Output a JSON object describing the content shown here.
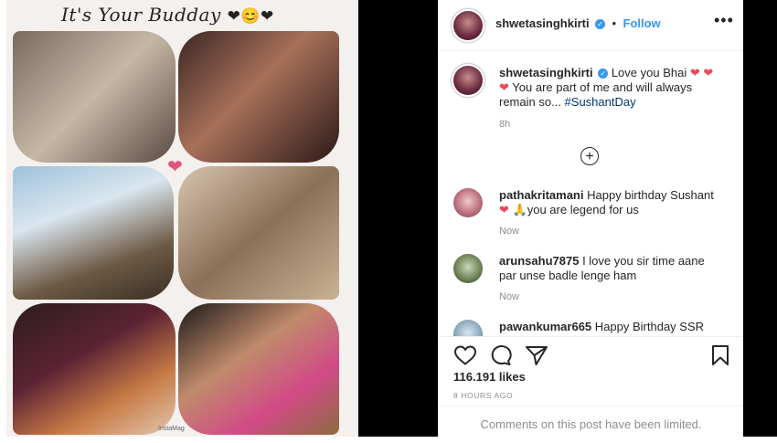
{
  "media": {
    "collage_title": "It's Your Budday",
    "collage_hearts": "❤😊❤",
    "collage_watermark": "InstaMag"
  },
  "header": {
    "username": "shwetasinghkirti",
    "verified_mark": "✓",
    "separator": "•",
    "follow_label": "Follow",
    "more_label": "•••"
  },
  "caption": {
    "username": "shwetasinghkirti",
    "verified_mark": "✓",
    "text_1": "Love you Bhai",
    "heart_1": "❤",
    "heart_2": "❤",
    "heart_3": "❤",
    "text_2": "You are part of me and will always remain so...",
    "hashtag": "#SushantDay",
    "time": "8h"
  },
  "load_more_label": "+",
  "comments": [
    {
      "username": "pathakritamani",
      "text_before": "Happy birthday Sushant",
      "heart": "❤",
      "emoji": "🙏",
      "text_after": "you are legend for us",
      "time": "Now"
    },
    {
      "username": "arunsahu7875",
      "text": "I love you sir time aane par unse badle lenge ham",
      "time": "Now"
    },
    {
      "username": "pawankumar665",
      "text": "Happy Birthday SSR",
      "time": ""
    }
  ],
  "stats": {
    "likes": "116.191 likes",
    "posted": "8 HOURS AGO"
  },
  "footer": {
    "comments_limited": "Comments on this post have been limited."
  },
  "icons": {
    "like": "heart-outline-icon",
    "comment": "comment-bubble-icon",
    "share": "paper-plane-icon",
    "save": "bookmark-icon"
  },
  "colors": {
    "link_blue": "#3897f0",
    "hashtag_blue": "#00376b",
    "heart_red": "#ed4956",
    "muted_gray": "#8e8e8e"
  }
}
